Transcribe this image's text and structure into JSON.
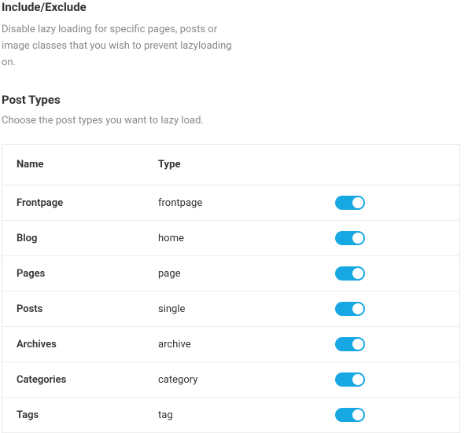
{
  "section": {
    "title": "Include/Exclude",
    "description": "Disable lazy loading for specific pages, posts or image classes that you wish to prevent lazyloading on."
  },
  "subsection": {
    "title": "Post Types",
    "description": "Choose the post types you want to lazy load."
  },
  "table": {
    "headers": {
      "name": "Name",
      "type": "Type"
    },
    "rows": [
      {
        "name": "Frontpage",
        "type": "frontpage",
        "enabled": true
      },
      {
        "name": "Blog",
        "type": "home",
        "enabled": true
      },
      {
        "name": "Pages",
        "type": "page",
        "enabled": true
      },
      {
        "name": "Posts",
        "type": "single",
        "enabled": true
      },
      {
        "name": "Archives",
        "type": "archive",
        "enabled": true
      },
      {
        "name": "Categories",
        "type": "category",
        "enabled": true
      },
      {
        "name": "Tags",
        "type": "tag",
        "enabled": true
      }
    ]
  }
}
